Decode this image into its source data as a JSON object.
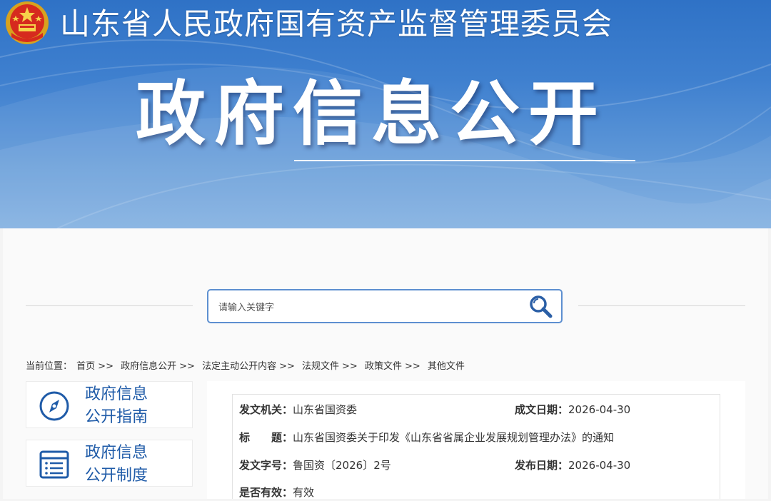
{
  "header": {
    "site_title": "山东省人民政府国有资产监督管理委员会",
    "section_title": "政府信息公开"
  },
  "search": {
    "placeholder": "请输入关键字"
  },
  "breadcrumb": {
    "prefix": "当前位置：",
    "items": [
      "首页",
      "政府信息公开",
      "法定主动公开内容",
      "法规文件",
      "政策文件",
      "其他文件"
    ],
    "separator": ">>"
  },
  "sidebar": {
    "items": [
      {
        "line1": "政府信息",
        "line2": "公开指南",
        "icon": "compass-icon"
      },
      {
        "line1": "政府信息",
        "line2": "公开制度",
        "icon": "list-document-icon"
      }
    ]
  },
  "document": {
    "issuer_label": "发文机关：",
    "issuer": "山东省国资委",
    "date_written_label": "成文日期：",
    "date_written": "2026-04-30",
    "title_label": "标　　题：",
    "title": "山东省国资委关于印发《山东省省属企业发展规划管理办法》的通知",
    "doc_number_label": "发文字号：",
    "doc_number": "鲁国资〔2026〕2号",
    "publish_date_label": "发布日期：",
    "publish_date": "2026-04-30",
    "valid_label": "是否有效：",
    "valid": "有效"
  },
  "colors": {
    "banner_blue": "#3f80cf",
    "link_blue": "#1f5ba8",
    "search_border": "#5d8fd0"
  }
}
